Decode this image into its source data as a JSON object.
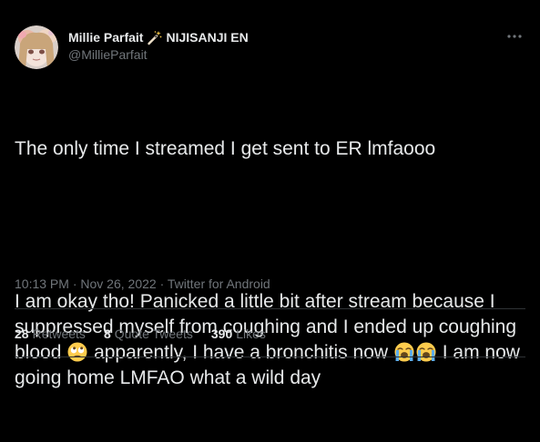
{
  "colors": {
    "background": "#000000",
    "primary_text": "#e7e9ea",
    "secondary_text": "#71767b",
    "divider": "#2f3336"
  },
  "author": {
    "display_name": "Millie Parfait",
    "name_suffix": "NIJISANJI EN",
    "handle": "@MillieParfait",
    "name_icon": "magic-wand-icon",
    "avatar": "avatar-image"
  },
  "more_icon": "more-dots-icon",
  "tweet": {
    "line1": "The only time I streamed I get sent to ER lmfaooo",
    "line2_part1": "I am okay tho! Panicked a little bit after stream because I suppressed myself from coughing and I ended up coughing blood",
    "emoji1": "face-with-rolling-eyes-emoji",
    "line2_part2": " apparently, I have a bronchitis now",
    "emoji2": "loudly-crying-face-emoji",
    "emoji3": "loudly-crying-face-emoji",
    "line2_part3": " I am now going home LMFAO what a wild day"
  },
  "meta": {
    "time": "10:13 PM",
    "separator1": " · ",
    "date": "Nov 26, 2022",
    "separator2": " · ",
    "source": "Twitter for Android"
  },
  "stats": {
    "retweets_count": "28",
    "retweets_label": "Retweets",
    "quotes_count": "8",
    "quotes_label": "Quote Tweets",
    "likes_count": "390",
    "likes_label": "Likes"
  }
}
